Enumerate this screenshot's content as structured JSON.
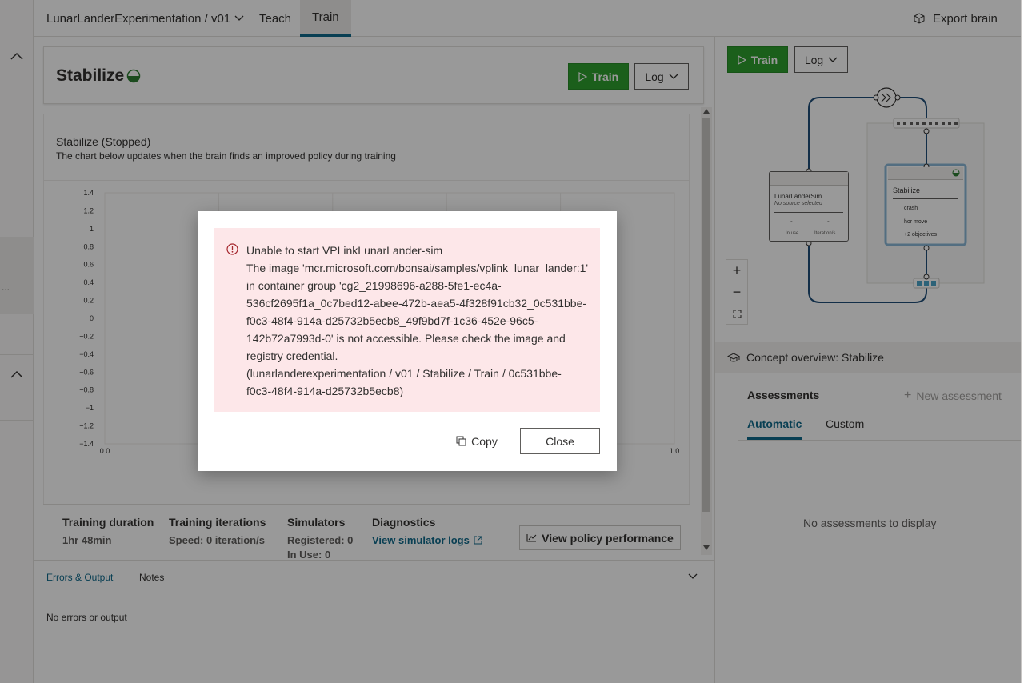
{
  "topbar": {
    "project": "LunarLanderExperimentation / v01",
    "tabs": [
      "Teach",
      "Train"
    ],
    "export_label": "Export brain"
  },
  "concept": {
    "title": "Stabilize",
    "train_label": "Train",
    "log_label": "Log"
  },
  "chart": {
    "title": "Stabilize (Stopped)",
    "subtitle": "The chart below updates when the brain finds an improved policy during training"
  },
  "chart_data": {
    "type": "line",
    "title": "",
    "xlabel": "",
    "ylabel": "",
    "xlim": [
      0.0,
      1.0
    ],
    "ylim": [
      -1.4,
      1.4
    ],
    "y_ticks": [
      "1.4",
      "1.2",
      "1",
      "0.8",
      "0.6",
      "0.4",
      "0.2",
      "0",
      "−0.2",
      "−0.4",
      "−0.6",
      "−0.8",
      "−1",
      "−1.2",
      "−1.4"
    ],
    "x_ticks": [
      "0.0",
      "1.0"
    ],
    "series": [],
    "grid": true
  },
  "stats": {
    "duration_label": "Training duration",
    "duration_value": "1hr 48min",
    "iterations_label": "Training iterations",
    "iterations_value": "Speed: 0 iteration/s",
    "sims_label": "Simulators",
    "sims_registered": "Registered: 0",
    "sims_inuse": "In Use: 0",
    "diag_label": "Diagnostics",
    "diag_link": "View simulator logs",
    "policy_button": "View policy performance"
  },
  "bottom": {
    "tabs": [
      "Errors & Output",
      "Notes"
    ],
    "empty_text": "No errors or output"
  },
  "right": {
    "train_label": "Train",
    "log_label": "Log",
    "sim_node_title": "LunarLanderSim",
    "sim_node_sub": "No source selected",
    "sim_node_dash1": "-",
    "sim_node_dash2": "-",
    "sim_node_col1": "In use",
    "sim_node_col2": "Iteration/s",
    "concept_node_title": "Stabilize",
    "concept_node_items": [
      "crash",
      "hor move",
      "+2 objectives"
    ],
    "overview_label": "Concept overview: Stabilize",
    "assessments_label": "Assessments",
    "new_assessment": "New assessment",
    "assess_tabs": [
      "Automatic",
      "Custom"
    ],
    "no_assess": "No assessments to display"
  },
  "rail": {
    "ellipsis": "..."
  },
  "dialog": {
    "lines": [
      "Unable to start VPLinkLunarLander-sim",
      "The image 'mcr.microsoft.com/bonsai/samples/vplink_lunar_lander:1'",
      "in container group 'cg2_21998696-a288-5fe1-ec4a-",
      "536cf2695f1a_0c7bed12-abee-472b-aea5-4f328f91cb32_0c531bbe-",
      "f0c3-48f4-914a-d25732b5ecb8_49f9bd7f-1c36-452e-96c5-",
      "142b72a7993d-0' is not accessible. Please check the image and",
      "registry credential.",
      "(lunarlanderexperimentation / v01 / Stabilize / Train / 0c531bbe-",
      "f0c3-48f4-914a-d25732b5ecb8)"
    ],
    "copy_label": "Copy",
    "close_label": "Close"
  }
}
